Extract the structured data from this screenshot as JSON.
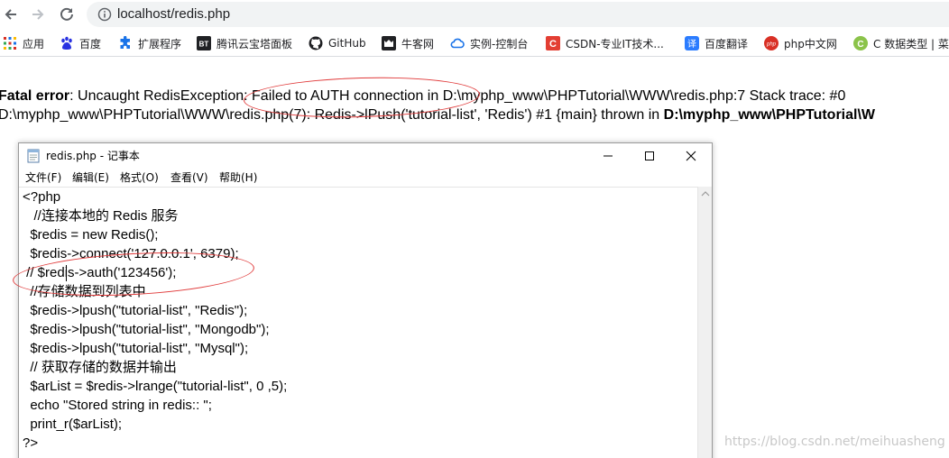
{
  "browser": {
    "url": "localhost/redis.php",
    "bookmarks": [
      {
        "label": "应用",
        "icon": "apps-grid-icon",
        "color": "#d93025"
      },
      {
        "label": "百度",
        "icon": "baidu-paw-icon",
        "color": "#2932e1"
      },
      {
        "label": "扩展程序",
        "icon": "puzzle-icon",
        "color": "#1a73e8"
      },
      {
        "label": "腾讯云宝塔面板",
        "icon": "bt-icon",
        "color": "#202124"
      },
      {
        "label": "GitHub",
        "icon": "github-icon",
        "color": "#202124"
      },
      {
        "label": "牛客网",
        "icon": "nowcoder-icon",
        "color": "#202124"
      },
      {
        "label": "实例-控制台",
        "icon": "cloud-icon",
        "color": "#1a73e8"
      },
      {
        "label": "CSDN-专业IT技术...",
        "icon": "csdn-icon",
        "color": "#e33e33"
      },
      {
        "label": "百度翻译",
        "icon": "translate-icon",
        "color": "#2b7cff"
      },
      {
        "label": "php中文网",
        "icon": "php-icon",
        "color": "#d93025"
      },
      {
        "label": "C 数据类型 | 菜",
        "icon": "runoob-icon",
        "color": "#8bc34a"
      }
    ]
  },
  "error": {
    "label": "Fatal error",
    "line1_rest": ": Uncaught RedisException: Failed to AUTH connection in D:\\myphp_www\\PHPTutorial\\WWW\\redis.php:7 Stack trace: #0",
    "line2_pre": "D:\\myphp_www\\PHPTutorial\\WWW\\redis.php(7): Redis->lPush('tutorial-list', 'Redis') #1 {main} thrown in ",
    "line2_bold": "D:\\myphp_www\\PHPTutorial\\W"
  },
  "notepad": {
    "title": "redis.php - 记事本",
    "menu": [
      "文件(F)",
      "编辑(E)",
      "格式(O)",
      "查看(V)",
      "帮助(H)"
    ],
    "lines": [
      "<?php",
      "   //连接本地的 Redis 服务",
      "  $redis = new Redis();",
      "  $redis->connect('127.0.0.1', 6379);",
      " // $redis->auth('123456');",
      "  //存储数据到列表中",
      "  $redis->lpush(\"tutorial-list\", \"Redis\");",
      "  $redis->lpush(\"tutorial-list\", \"Mongodb\");",
      "  $redis->lpush(\"tutorial-list\", \"Mysql\");",
      "  // 获取存储的数据并输出",
      "  $arList = $redis->lrange(\"tutorial-list\", 0 ,5);",
      "  echo \"Stored string in redis:: \";",
      "  print_r($arList);",
      "?>"
    ]
  },
  "watermark": "https://blog.csdn.net/meihuasheng",
  "colors": {
    "annotation": "#e03a3a",
    "omnibox": "#f1f3f4"
  }
}
